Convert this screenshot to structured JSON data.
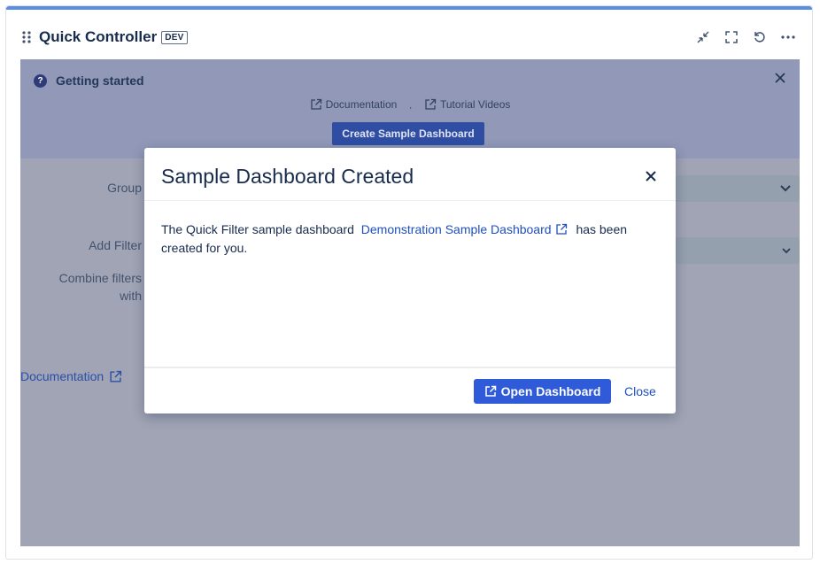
{
  "header": {
    "title": "Quick Controller",
    "badge": "DEV",
    "icons": [
      "collapse-icon",
      "fullscreen-icon",
      "refresh-icon",
      "more-icon"
    ]
  },
  "banner": {
    "title": "Getting started",
    "links": [
      "Documentation",
      "Tutorial Videos"
    ],
    "separator": "·",
    "create_button": "Create Sample Dashboard"
  },
  "form": {
    "group_label": "Group",
    "add_filter_label": "Add Filter",
    "combine_label_line1": "Combine filters",
    "combine_label_line2": "with",
    "documentation_link": "Documentation"
  },
  "modal": {
    "title": "Sample Dashboard Created",
    "body_prefix": "The Quick Filter sample dashboard",
    "body_link": "Demonstration Sample Dashboard",
    "body_suffix": "has been created for you.",
    "open_button": "Open Dashboard",
    "close_link": "Close"
  },
  "colors": {
    "accent": "#2f5ad8",
    "overlay": "#a0a4b4",
    "link": "#1f4fbf"
  }
}
